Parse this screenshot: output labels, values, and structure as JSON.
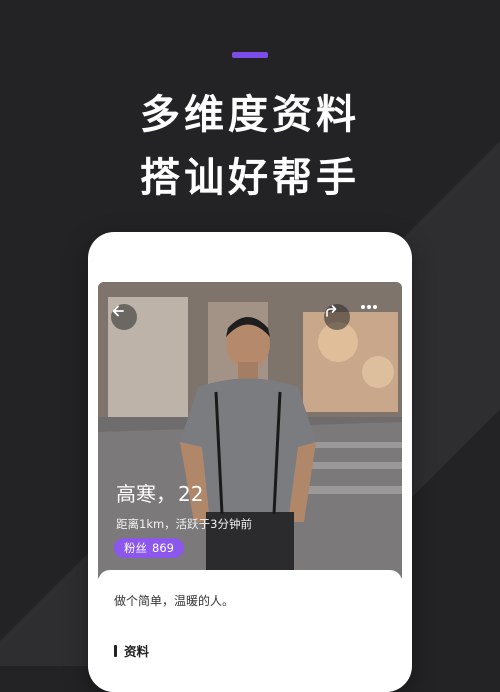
{
  "promo": {
    "line1": "多维度资料",
    "line2": "搭讪好帮手",
    "accent_color": "#7a4ee6"
  },
  "profile": {
    "name": "高寒，",
    "age": "22",
    "meta": "距离1km，活跃于3分钟前",
    "fans_label": "粉丝",
    "fans_count": "869",
    "bio": "做个简单，温暖的人。",
    "section_title": "资料"
  },
  "icons": {
    "back": "arrow-left-icon",
    "share": "share-arrow-icon",
    "more": "more-dots-icon"
  }
}
